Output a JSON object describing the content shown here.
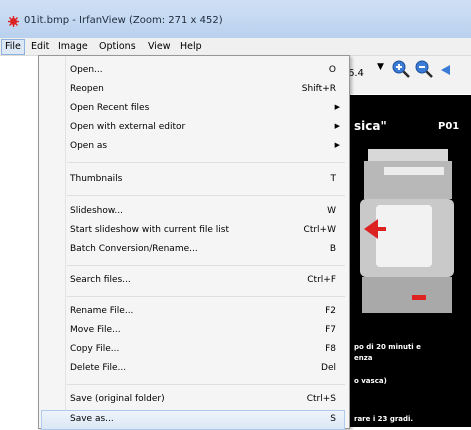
{
  "window": {
    "title": "01it.bmp - IrfanView (Zoom: 271 x 452)"
  },
  "menubar": {
    "items": [
      "File",
      "Edit",
      "Image",
      "Options",
      "View",
      "Help"
    ]
  },
  "toolbar": {
    "zoom_value": "6.4"
  },
  "file_menu": {
    "items": [
      {
        "label": "Open...",
        "shortcut": "O"
      },
      {
        "label": "Reopen",
        "shortcut": "Shift+R"
      },
      {
        "label": "Open Recent files",
        "shortcut": "",
        "submenu": true
      },
      {
        "label": "Open with external editor",
        "shortcut": "",
        "submenu": true
      },
      {
        "label": "Open as",
        "shortcut": "",
        "submenu": true
      },
      {
        "label": "Thumbnails",
        "shortcut": "T"
      },
      {
        "label": "Slideshow...",
        "shortcut": "W"
      },
      {
        "label": "Start slideshow with current file list",
        "shortcut": "Ctrl+W"
      },
      {
        "label": "Batch Conversion/Rename...",
        "shortcut": "B"
      },
      {
        "label": "Search files...",
        "shortcut": "Ctrl+F"
      },
      {
        "label": "Rename File...",
        "shortcut": "F2"
      },
      {
        "label": "Move File...",
        "shortcut": "F7"
      },
      {
        "label": "Copy File...",
        "shortcut": "F8"
      },
      {
        "label": "Delete File...",
        "shortcut": "Del"
      },
      {
        "label": "Save (original folder)",
        "shortcut": "Ctrl+S"
      },
      {
        "label": "Save as...",
        "shortcut": "S"
      }
    ]
  },
  "image": {
    "title": "sica\"",
    "code": "P01",
    "lines": [
      "po di 20 minuti e",
      "enza",
      "o vasca)",
      "rare i 23 gradi."
    ]
  }
}
